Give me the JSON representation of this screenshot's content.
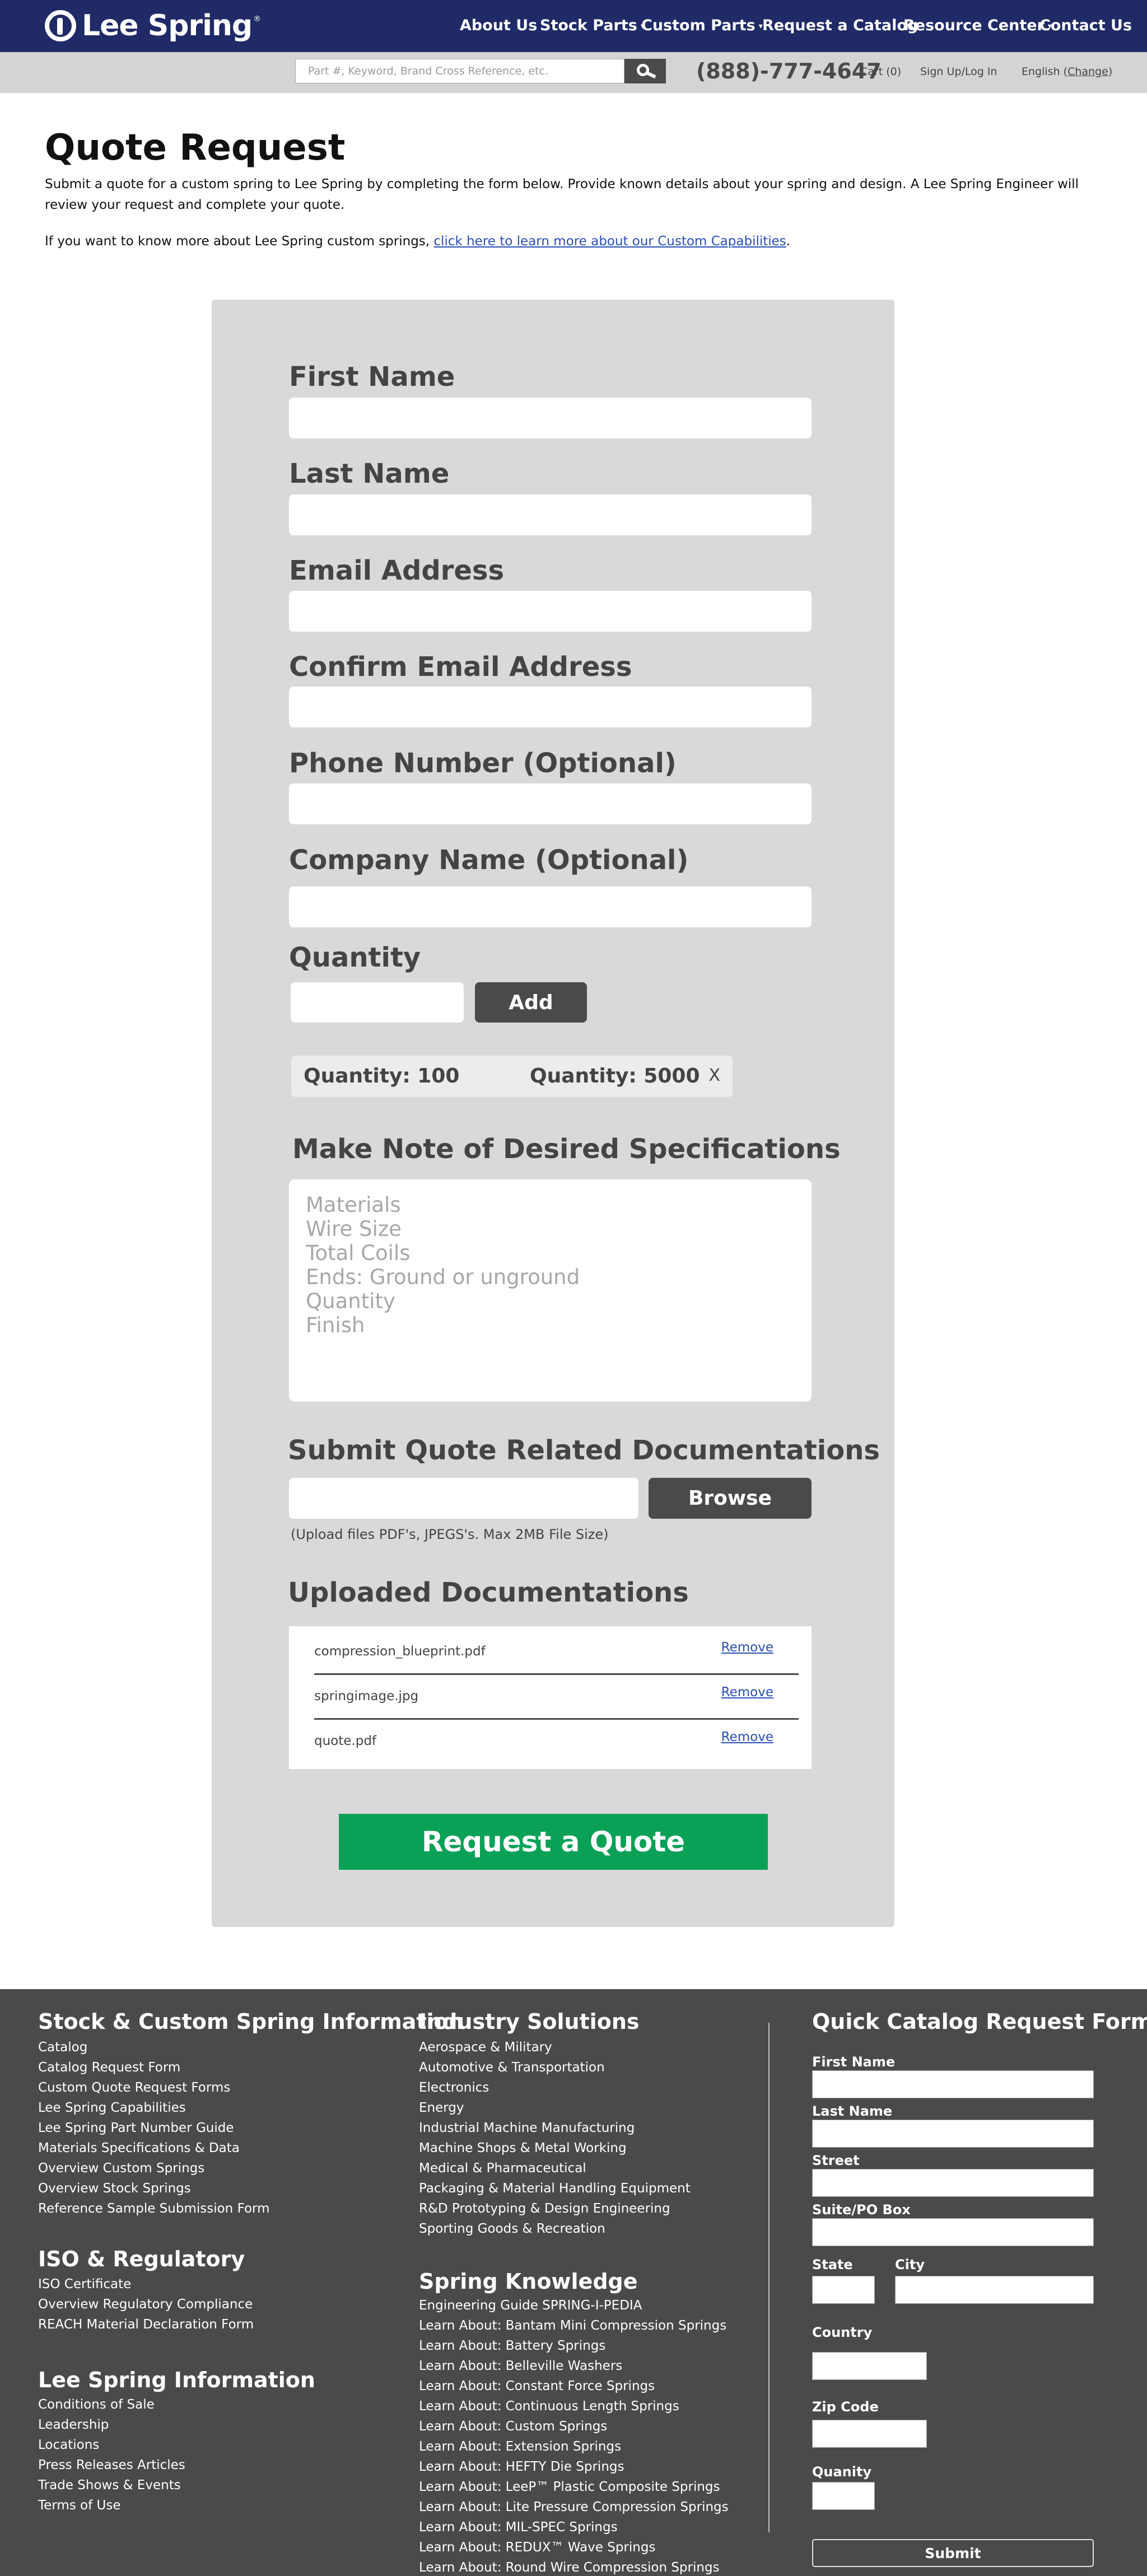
{
  "brand": {
    "name": "Lee Spring",
    "reg": "®"
  },
  "nav": {
    "about_us": "About Us",
    "stock_parts": "Stock Parts",
    "custom_parts": "Custom Parts",
    "request_catalog": "Request a Catalog",
    "resource_center": "Resource Center",
    "contact_us": "Contact Us"
  },
  "search": {
    "placeholder": "Part #, Keyword, Brand Cross Reference, etc."
  },
  "utility": {
    "phone": "(888)-777-4647",
    "cart": "Cart (0)",
    "sign_in": "Sign Up/Log In",
    "language": "English",
    "change": "Change"
  },
  "intro": {
    "title": "Quote Request",
    "text": "Submit a quote for a custom spring to Lee Spring by completing the form below. Provide known details about your spring and design. A Lee Spring Engineer will review your request and complete your quote.",
    "custom_prefix": "If you want to know more about Lee Spring custom springs, ",
    "custom_link": "click here to learn more about our Custom Capabilities",
    "custom_suffix": "."
  },
  "form": {
    "first_name_label": "First Name",
    "last_name_label": "Last Name",
    "email_label": "Email Address",
    "confirm_email_label": "Confirm Email Address",
    "phone_label": "Phone Number (Optional)",
    "company_label": "Company Name (Optional)",
    "quantity_label": "Quantity",
    "add_label": "Add",
    "quantities": [
      {
        "label": "Quantity: 100",
        "remove": "X"
      },
      {
        "label": "Quantity: 5000",
        "remove": "X"
      }
    ],
    "specs_label": "Make Note of Desired Specifications",
    "specs_placeholder": "Materials\nWire Size\nTotal Coils\nEnds: Ground or unground\nQuantity\nFinish",
    "docs_label": "Submit Quote Related Documentations",
    "browse_label": "Browse",
    "upload_note": "(Upload files PDF's, JPEGS's. Max 2MB File Size)",
    "uploaded_label": "Uploaded Documentations",
    "uploaded_files": [
      {
        "name": "compression_blueprint.pdf",
        "remove": "Remove"
      },
      {
        "name": "springimage.jpg",
        "remove": "Remove"
      },
      {
        "name": "quote.pdf",
        "remove": "Remove"
      }
    ],
    "submit_label": "Request a Quote",
    "submit_color": "#0aa157"
  },
  "footer": {
    "info_heading": "Stock & Custom Spring Information",
    "info_links": [
      "Catalog",
      "Catalog Request Form",
      "Custom Quote Request Forms",
      "Lee Spring Capabilities",
      "Lee Spring Part Number Guide",
      "Materials Specifications & Data",
      "Overview Custom Springs",
      "Overview Stock Springs",
      "Reference Sample Submission Form"
    ],
    "iso_heading": "ISO & Regulatory",
    "iso_links": [
      "ISO Certificate",
      "Overview Regulatory Compliance",
      "REACH Material Declaration Form"
    ],
    "company_heading": "Lee Spring Information",
    "company_links": [
      "Conditions of Sale",
      "Leadership",
      "Locations",
      "Press Releases Articles",
      "Trade Shows & Events",
      "Terms of Use"
    ],
    "industry_heading": "Industry Solutions",
    "industry_links": [
      "Aerospace & Military",
      "Automotive & Transportation",
      "Electronics",
      "Energy",
      "Industrial Machine Manufacturing",
      "Machine Shops & Metal Working",
      "Medical & Pharmaceutical",
      "Packaging & Material Handling Equipment",
      "R&D Prototyping & Design Engineering",
      "Sporting Goods & Recreation"
    ],
    "knowledge_heading": "Spring Knowledge",
    "knowledge_links": [
      "Engineering Guide SPRING-I-PEDIA",
      "Learn About: Bantam Mini Compression Springs",
      "Learn About: Battery Springs",
      "Learn About: Belleville Washers",
      "Learn About: Constant Force Springs",
      "Learn About: Continuous Length Springs",
      "Learn About: Custom Springs",
      "Learn About: Extension Springs",
      "Learn About: HEFTY Die Springs",
      "Learn About: LeeP™ Plastic Composite Springs",
      "Learn About: Lite Pressure Compression Springs",
      "Learn About: MIL-SPEC Springs",
      "Learn About: REDUX™ Wave Springs",
      "Learn About: Round Wire Compression Springs"
    ],
    "quick_heading": "Quick Catalog Request Form",
    "quick": {
      "first_name": "First Name",
      "last_name": "Last Name",
      "street": "Street",
      "suite": "Suite/PO Box",
      "state": "State",
      "city": "City",
      "country": "Country",
      "zip": "Zip Code",
      "quantity": "Quanity",
      "submit": "Submit"
    }
  }
}
